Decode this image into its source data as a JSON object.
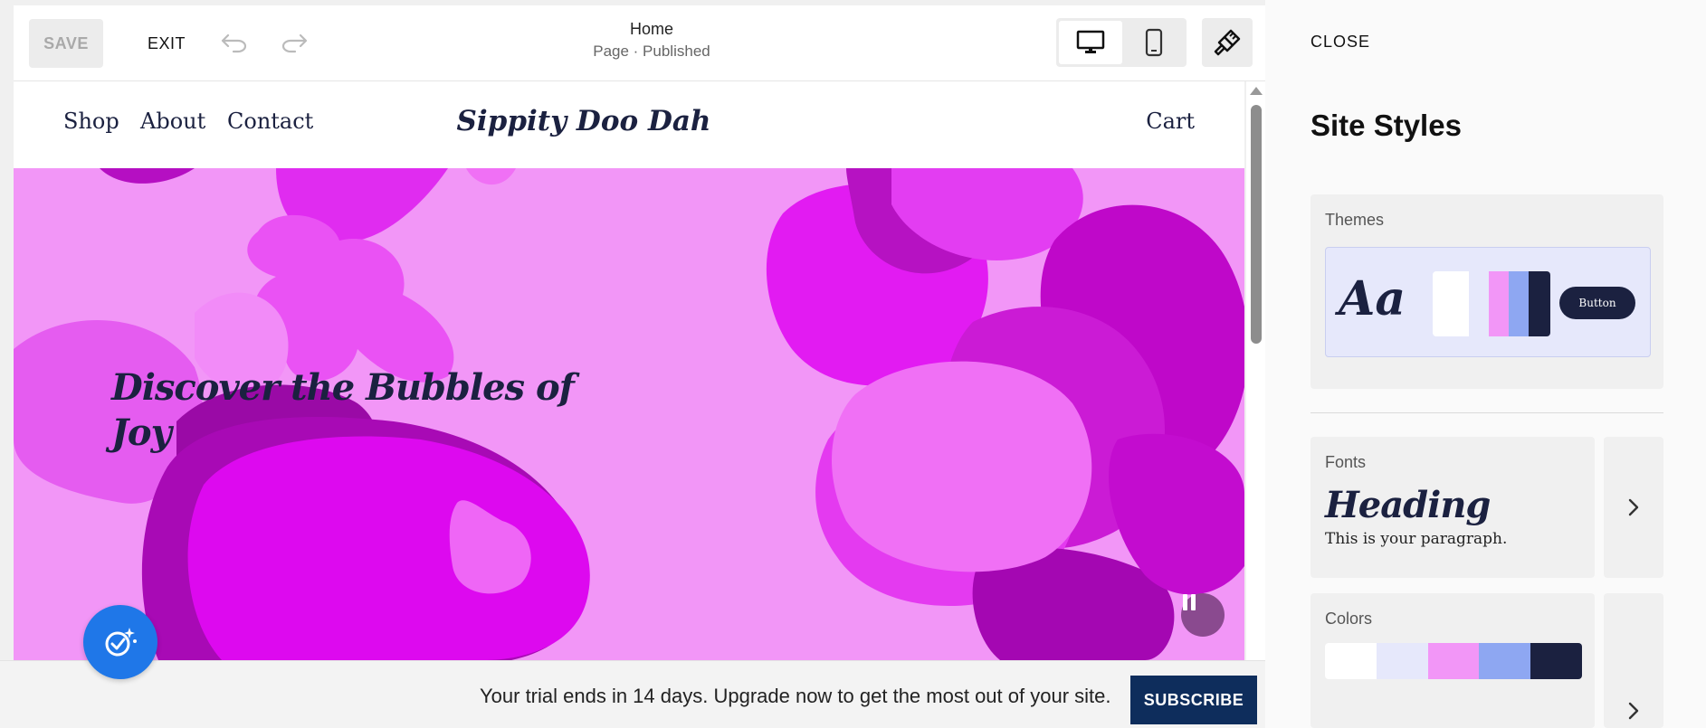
{
  "toolbar": {
    "save_label": "SAVE",
    "exit_label": "EXIT",
    "page_title": "Home",
    "page_status": "Page · Published"
  },
  "site": {
    "nav": [
      "Shop",
      "About",
      "Contact"
    ],
    "logo": "Sippity Doo Dah",
    "cart": "Cart",
    "hero_heading": "Discover the Bubbles of Joy"
  },
  "banner": {
    "text": "Your trial ends in 14 days. Upgrade now to get the most out of your site.",
    "subscribe_label": "SUBSCRIBE"
  },
  "panel": {
    "close_label": "CLOSE",
    "title": "Site Styles",
    "themes": {
      "label": "Themes",
      "sample_text": "Aa",
      "button_label": "Button",
      "swatches": [
        "#ffffff",
        "#e6e8fb",
        "#f296f7",
        "#8ea7f2",
        "#1b2140"
      ]
    },
    "fonts": {
      "label": "Fonts",
      "heading_sample": "Heading",
      "paragraph_sample": "This is your paragraph."
    },
    "colors": {
      "label": "Colors",
      "palette": [
        "#ffffff",
        "#e6e8fb",
        "#f296f7",
        "#8ea7f2",
        "#1b2140"
      ]
    }
  },
  "icons": {
    "undo": "undo-icon",
    "redo": "redo-icon",
    "desktop": "desktop-icon",
    "mobile": "mobile-icon",
    "styles": "paintbrush-icon",
    "pause": "pause-icon",
    "assistant": "sparkle-check-icon",
    "chevron": "chevron-right-icon"
  },
  "colors": {
    "hero_background": "#f296f7",
    "accent_navy": "#1b2140",
    "subscribe_bg": "#0e2d5c",
    "assistant_blue": "#1f77e8"
  }
}
